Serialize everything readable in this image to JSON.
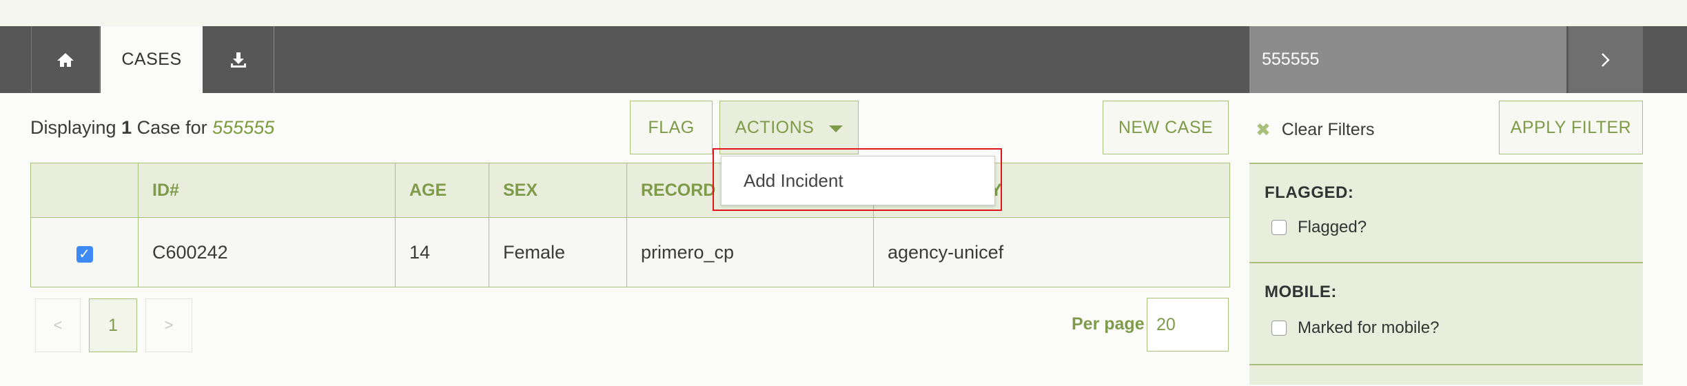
{
  "nav": {
    "cases_label": "CASES",
    "search_value": "555555"
  },
  "summary": {
    "prefix": "Displaying ",
    "count": "1",
    "middle": " Case for ",
    "query": "555555"
  },
  "toolbar": {
    "flag_label": "FLAG",
    "actions_label": "ACTIONS",
    "new_case_label": "NEW CASE",
    "apply_filter_label": "APPLY FILTER"
  },
  "actions_menu": {
    "items": [
      "Add Incident"
    ]
  },
  "table": {
    "headers": [
      "",
      "ID#",
      "AGE",
      "SEX",
      "RECORD O",
      "NER AGENCY"
    ],
    "rows": [
      {
        "checked": true,
        "id": "C600242",
        "age": "14",
        "sex": "Female",
        "record_owner": "primero_cp",
        "owner_agency": "agency-unicef"
      }
    ]
  },
  "pagination": {
    "prev": "<",
    "current": "1",
    "next": ">",
    "per_page_label": "Per page",
    "per_page_value": "20"
  },
  "filters": {
    "clear_label": "Clear Filters",
    "sections": [
      {
        "title": "FLAGGED:",
        "option": "Flagged?"
      },
      {
        "title": "MOBILE:",
        "option": "Marked for mobile?"
      }
    ]
  },
  "colors": {
    "accent_green": "#7e9b4a",
    "navbar": "#575757",
    "highlight_red": "#e0141b"
  }
}
